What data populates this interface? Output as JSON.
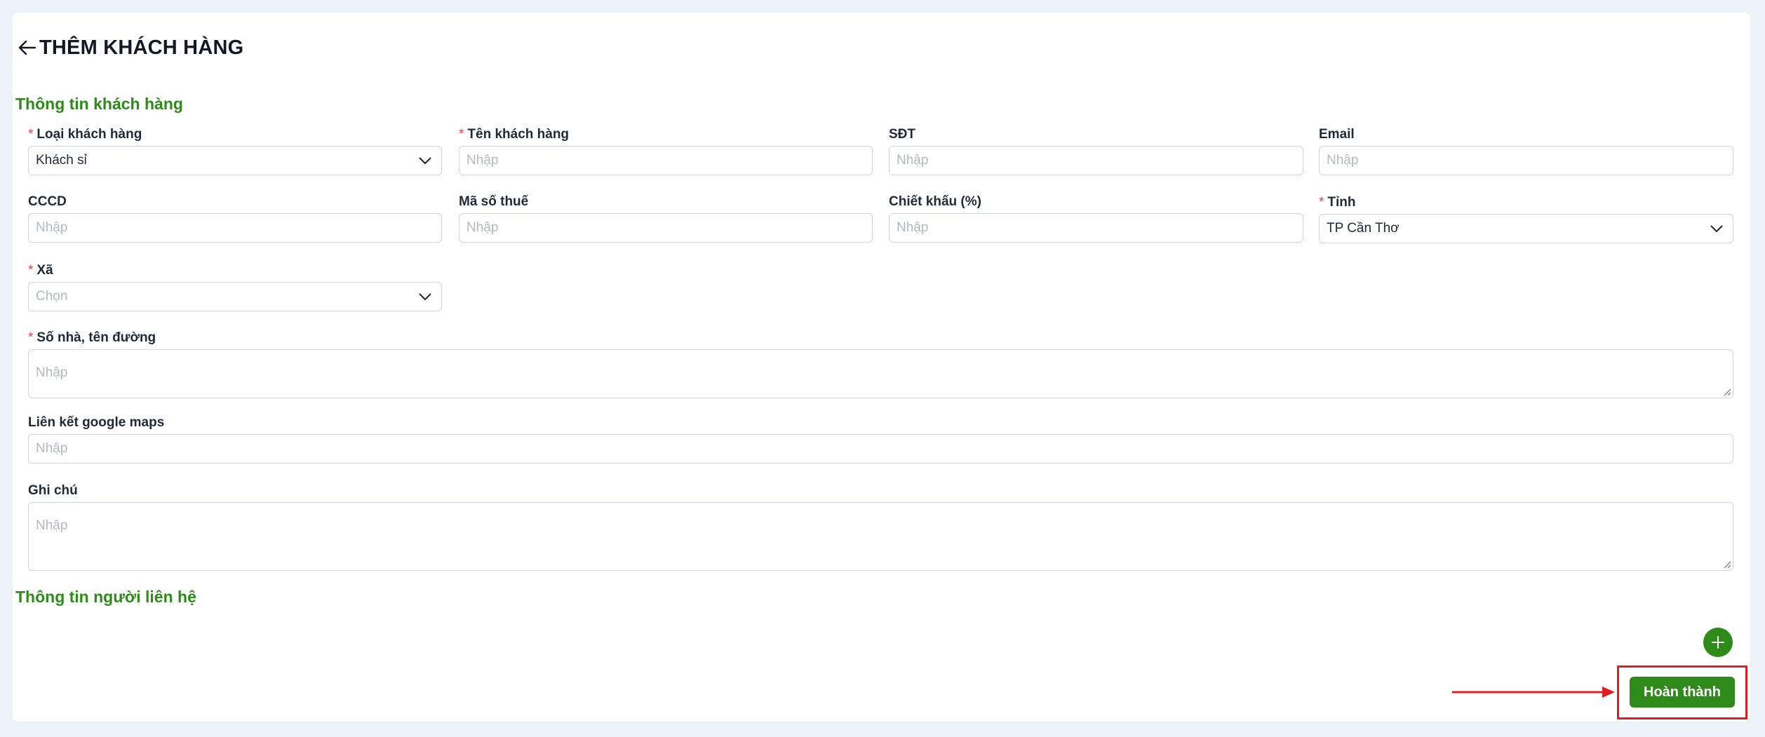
{
  "header": {
    "title": "THÊM KHÁCH HÀNG",
    "back_icon": "arrow-left-icon"
  },
  "sections": {
    "customer_info": "Thông tin khách hàng",
    "contact_info": "Thông tin người liên hệ"
  },
  "fields": {
    "customer_type": {
      "label": "Loại khách hàng",
      "value": "Khách sỉ",
      "required": true
    },
    "customer_name": {
      "label": "Tên khách hàng",
      "placeholder": "Nhập",
      "required": true
    },
    "phone": {
      "label": "SĐT",
      "placeholder": "Nhập"
    },
    "email": {
      "label": "Email",
      "placeholder": "Nhập"
    },
    "id_card": {
      "label": "CCCD",
      "placeholder": "Nhập"
    },
    "tax_code": {
      "label": "Mã số thuế",
      "placeholder": "Nhập"
    },
    "discount": {
      "label": "Chiết khấu (%)",
      "placeholder": "Nhập"
    },
    "province": {
      "label": "Tỉnh",
      "value": "TP Cần Thơ",
      "required": true
    },
    "ward": {
      "label": "Xã",
      "placeholder": "Chọn",
      "required": true
    },
    "address": {
      "label": "Số nhà, tên đường",
      "placeholder": "Nhập",
      "required": true
    },
    "maps_link": {
      "label": "Liên kết google maps",
      "placeholder": "Nhập"
    },
    "note": {
      "label": "Ghi chú",
      "placeholder": "Nhập"
    }
  },
  "actions": {
    "add_contact_icon": "plus-icon",
    "finish_label": "Hoàn thành"
  },
  "colors": {
    "accent": "#2e8b1a",
    "required": "#e5484d",
    "highlight": "#e11d24",
    "background": "#eaf3f8"
  }
}
